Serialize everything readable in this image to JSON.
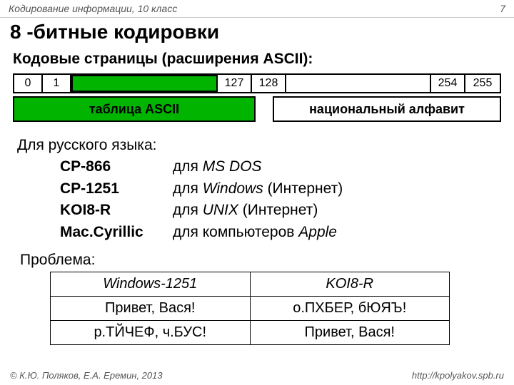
{
  "header": {
    "left": "Кодирование информации, 10 класс",
    "right": "7"
  },
  "title": "8 -битные кодировки",
  "subtitle": "Кодовые страницы (расширения ASCII):",
  "range": {
    "n0": "0",
    "n1": "1",
    "n127": "127",
    "n128": "128",
    "n254": "254",
    "n255": "255",
    "ascii_label": "таблица ASCII",
    "national_label": "национальный алфавит"
  },
  "russian_intro": "Для русского языка:",
  "codepages": [
    {
      "name": "CP-866",
      "for_prefix": "для ",
      "for_em": "MS DOS",
      "for_suffix": ""
    },
    {
      "name": "CP-1251",
      "for_prefix": "для ",
      "for_em": "Windows",
      "for_suffix": " (Интернет)"
    },
    {
      "name": "KOI8-R",
      "for_prefix": "для ",
      "for_em": "UNIX",
      "for_suffix": " (Интернет)"
    },
    {
      "name": "Mac.Cyrillic",
      "for_prefix": "для компьютеров ",
      "for_em": "Apple",
      "for_suffix": ""
    }
  ],
  "problem_label": "Проблема:",
  "problem_table": {
    "h1": "Windows-1251",
    "h2": "KOI8-R",
    "r1c1": "Привет, Вася!",
    "r1c2": "о.ПХБЕР, бЮЯЪ!",
    "r2c1": "р.ТЙЧЕФ, ч.БУС!",
    "r2c2": "Привет, Вася!"
  },
  "footer": {
    "left": "© К.Ю. Поляков, Е.А. Еремин, 2013",
    "right": "http://kpolyakov.spb.ru"
  }
}
